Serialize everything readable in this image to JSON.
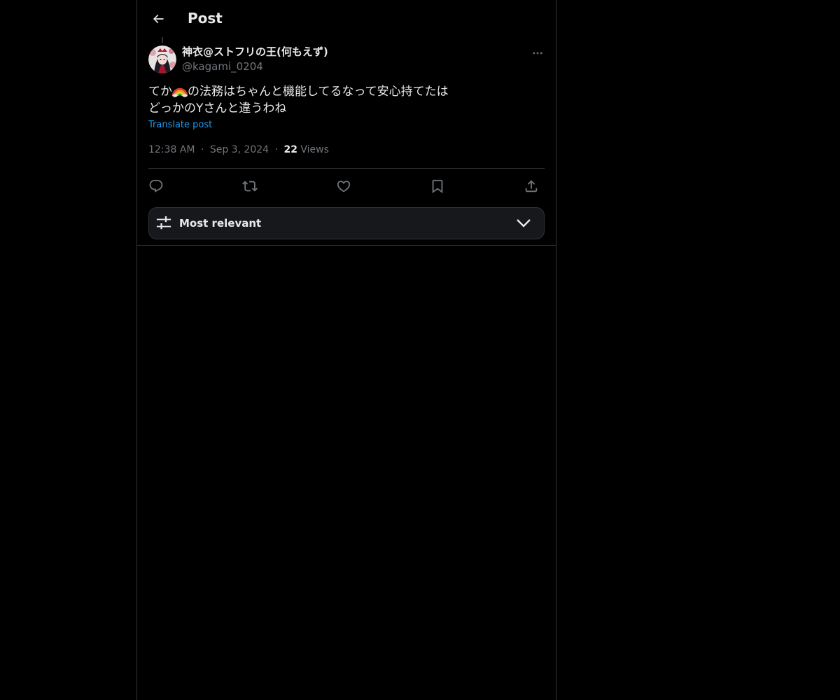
{
  "header": {
    "back_icon": "arrow-left-icon",
    "title": "Post"
  },
  "post": {
    "author": {
      "name": "神衣@ストフリの王(何もえず)",
      "handle": "@kagami_0204"
    },
    "more_icon": "more-horizontal-icon",
    "text": {
      "line1_prefix": "てか",
      "line1_emoji": "rainbow-emoji",
      "line1_suffix": "の法務はちゃんと機能してるなって安心持てたは",
      "line2": "どっかのYさんと違うわね"
    },
    "translate_label": "Translate post",
    "meta": {
      "time": "12:38 AM",
      "separator": "·",
      "date": "Sep 3, 2024",
      "views_count": "22",
      "views_label": "Views"
    },
    "actions": [
      {
        "icon": "reply-icon"
      },
      {
        "icon": "retweet-icon"
      },
      {
        "icon": "like-icon"
      },
      {
        "icon": "bookmark-icon"
      },
      {
        "icon": "share-icon"
      }
    ]
  },
  "replies_sort": {
    "icon": "sliders-icon",
    "label": "Most relevant",
    "chevron": "chevron-down-icon"
  },
  "colors": {
    "background": "#000000",
    "text": "#e7e9ea",
    "muted": "#71767b",
    "link": "#1d9bf0",
    "border": "#2f3336"
  }
}
